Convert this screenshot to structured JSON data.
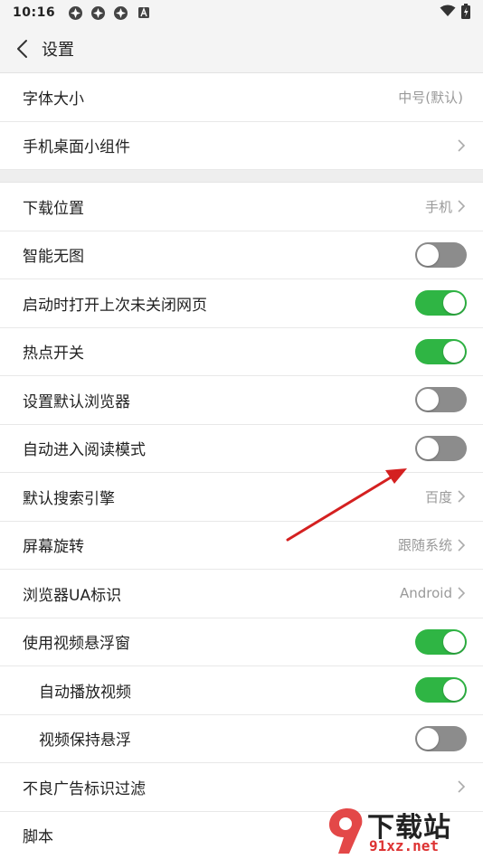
{
  "status_bar": {
    "time": "10:16"
  },
  "header": {
    "title": "设置"
  },
  "group1": [
    {
      "label": "字体大小",
      "value": "中号(默认)"
    },
    {
      "label": "手机桌面小组件"
    }
  ],
  "group2": {
    "download": {
      "label": "下载位置",
      "value": "手机"
    },
    "smart_no_image": {
      "label": "智能无图",
      "state": "off"
    },
    "restore_pages": {
      "label": "启动时打开上次未关闭网页",
      "state": "on"
    },
    "hotspot": {
      "label": "热点开关",
      "state": "on"
    },
    "default_browser": {
      "label": "设置默认浏览器",
      "state": "off"
    },
    "auto_reader": {
      "label": "自动进入阅读模式",
      "state": "off"
    },
    "search_engine": {
      "label": "默认搜索引擎",
      "value": "百度"
    },
    "rotation": {
      "label": "屏幕旋转",
      "value": "跟随系统"
    },
    "ua": {
      "label": "浏览器UA标识",
      "value": "Android"
    },
    "float_video": {
      "label": "使用视频悬浮窗",
      "state": "on"
    },
    "autoplay": {
      "label": "自动播放视频",
      "state": "on"
    },
    "keep_float": {
      "label": "视频保持悬浮",
      "state": "off"
    },
    "ad_filter": {
      "label": "不良广告标识过滤"
    },
    "scripts": {
      "label": "脚本"
    }
  },
  "watermark": {
    "brand": "下载站",
    "url": "91xz.net"
  },
  "colors": {
    "toggle_on": "#2fb544",
    "toggle_off": "#8c8c8c",
    "arrow": "#d42020"
  }
}
